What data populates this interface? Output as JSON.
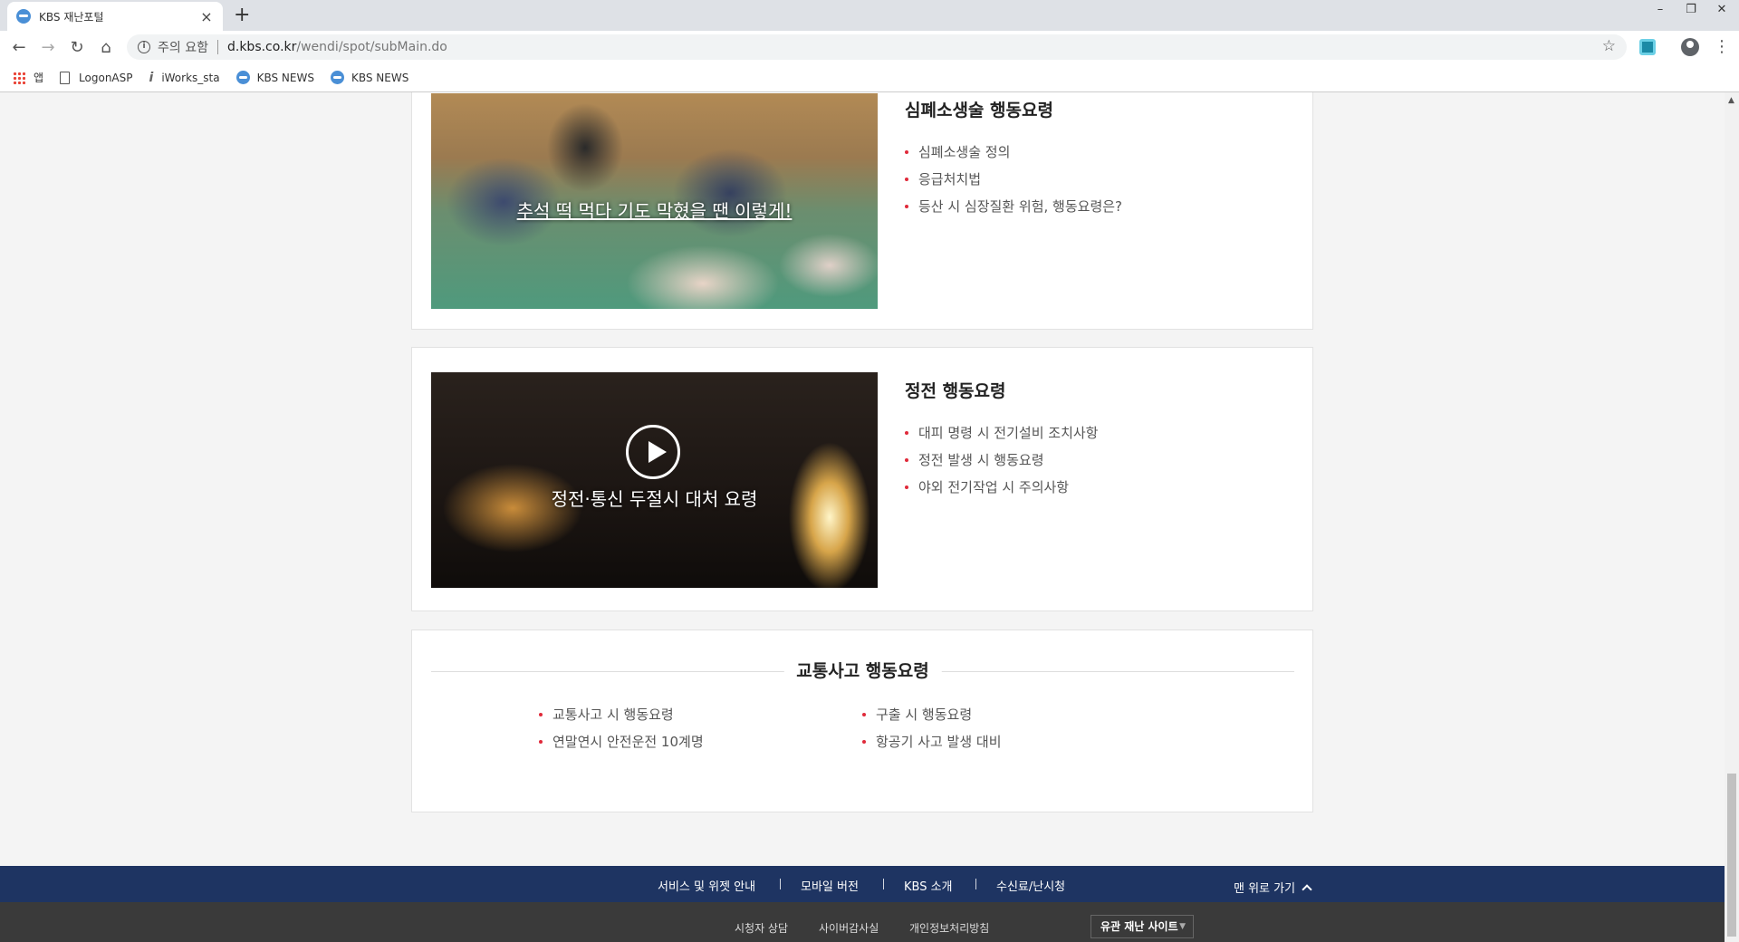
{
  "browser": {
    "tab_title": "KBS 재난포털",
    "tab_close": "×",
    "new_tab": "+",
    "address": {
      "warning": "주의 요함",
      "host": "d.kbs.co.kr",
      "path": "/wendi/spot/subMain.do"
    },
    "window_controls": {
      "minimize": "–",
      "restore": "❐",
      "close": "✕"
    },
    "nav": {
      "back": "←",
      "forward": "→",
      "reload": "↻",
      "home": "⌂"
    },
    "star": "☆",
    "menu": "⋮",
    "bookmarks": [
      {
        "label": "앱",
        "icon": "apps-icon"
      },
      {
        "label": "LogonASP",
        "icon": "page-icon"
      },
      {
        "label": "iWorks_sta",
        "icon": "iworks-icon"
      },
      {
        "label": "KBS NEWS",
        "icon": "kbs-icon"
      },
      {
        "label": "KBS NEWS",
        "icon": "kbs-icon"
      }
    ]
  },
  "cards": [
    {
      "caption": "추석 떡 먹다 기도 막혔을 땐 이렇게!",
      "title": "심폐소생술 행동요령",
      "items": [
        "심폐소생술 정의",
        "응급처치법",
        "등산 시 심장질환 위험, 행동요령은?"
      ]
    },
    {
      "caption": "정전·통신 두절시 대처 요령",
      "title": "정전 행동요령",
      "items": [
        "대피 명령 시 전기설비 조치사항",
        "정전 발생 시 행동요령",
        "야외 전기작업 시 주의사항"
      ]
    }
  ],
  "traffic": {
    "title": "교통사고 행동요령",
    "left": [
      "교통사고 시 행동요령",
      "연말연시 안전운전 10계명"
    ],
    "right": [
      "구출 시 행동요령",
      "항공기 사고 발생 대비"
    ]
  },
  "footer": {
    "nav": [
      "서비스 및 위젯 안내",
      "모바일 버전",
      "KBS 소개",
      "수신료/난시청"
    ],
    "top_link": "맨 위로 가기",
    "bottom": [
      "시청자 상담",
      "사이버감사실",
      "개인정보처리방침"
    ],
    "related": "유관 재난 사이트",
    "related_caret": "▼"
  },
  "colors": {
    "accent_bullet": "#e02a3a",
    "footer_nav": "#1e3462",
    "footer_bottom": "#3a3a3a"
  }
}
